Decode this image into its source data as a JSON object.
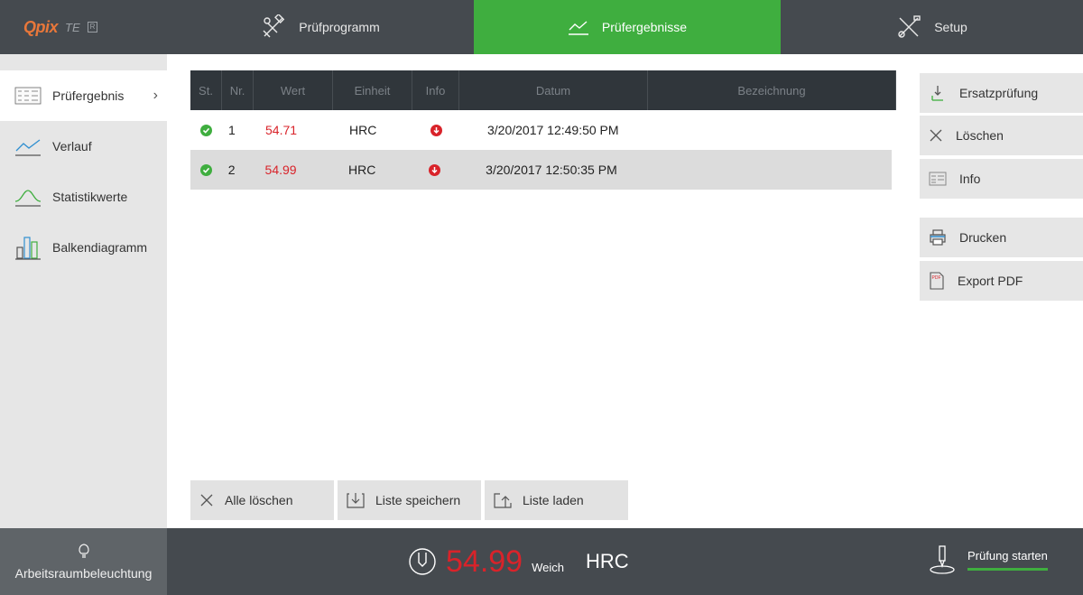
{
  "app": {
    "logo_main": "Qpix",
    "logo_sub": "TE",
    "logo_badge": "R"
  },
  "nav": {
    "programm": "Prüfprogramm",
    "ergebnisse": "Prüfergebnisse",
    "setup": "Setup"
  },
  "sidebar": {
    "items": [
      {
        "label": "Prüfergebnis"
      },
      {
        "label": "Verlauf"
      },
      {
        "label": "Statistikwerte"
      },
      {
        "label": "Balkendiagramm"
      }
    ],
    "chevron": "›"
  },
  "table": {
    "headers": [
      "St.",
      "Nr.",
      "Wert",
      "Einheit",
      "Info",
      "Datum",
      "Bezeichnung"
    ],
    "rows": [
      {
        "nr": "1",
        "wert": "54.71",
        "einheit": "HRC",
        "datum": "3/20/2017 12:49:50 PM",
        "bezeichnung": ""
      },
      {
        "nr": "2",
        "wert": "54.99",
        "einheit": "HRC",
        "datum": "3/20/2017 12:50:35 PM",
        "bezeichnung": ""
      }
    ]
  },
  "actions": {
    "alle_loeschen": "Alle löschen",
    "liste_speichern": "Liste speichern",
    "liste_laden": "Liste laden"
  },
  "right": {
    "ersatz": "Ersatzprüfung",
    "loeschen": "Löschen",
    "info": "Info",
    "drucken": "Drucken",
    "export": "Export PDF",
    "pdf_tag": "PDF"
  },
  "footer": {
    "light": "Arbeitsraumbeleuchtung",
    "value": "54.99",
    "hardness": "Weich",
    "unit": "HRC",
    "start": "Prüfung starten"
  },
  "colors": {
    "accent": "#3fae3f",
    "error": "#d9232a",
    "bar": "#454a4f"
  }
}
